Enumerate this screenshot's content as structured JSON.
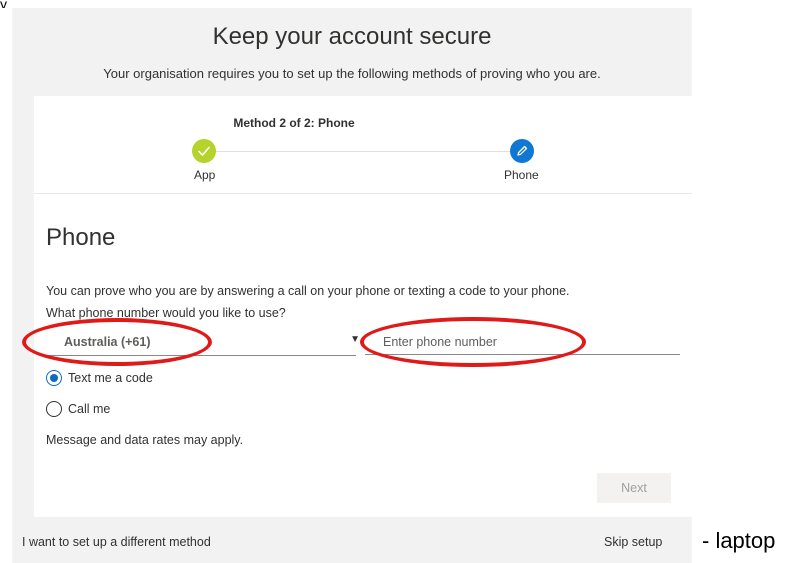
{
  "page": {
    "title": "Keep your account secure",
    "subtitle": "Your organisation requires you to set up the following methods of proving who you are."
  },
  "progress": {
    "label": "Method 2 of 2: Phone",
    "steps": [
      {
        "name": "App",
        "status": "complete",
        "icon": "check-icon",
        "color": "#b4d32c"
      },
      {
        "name": "Phone",
        "status": "current",
        "icon": "pencil-icon",
        "color": "#0f78d4"
      }
    ]
  },
  "section": {
    "title": "Phone",
    "description": "You can prove who you are by answering a call on your phone or texting a code to your phone.",
    "question": "What phone number would you like to use?"
  },
  "country": {
    "selected": "Australia (+61)"
  },
  "phone_input": {
    "placeholder": "Enter phone number",
    "value": ""
  },
  "options": [
    {
      "label": "Text me a code",
      "checked": true
    },
    {
      "label": "Call me",
      "checked": false
    }
  ],
  "rates_note": "Message and data rates may apply.",
  "buttons": {
    "next": "Next"
  },
  "footer": {
    "different_method": "I want to set up a different method",
    "skip": "Skip setup"
  },
  "annotation": {
    "side_note": "- laptop",
    "top_fragment": "y",
    "ellipse_color": "#e01919"
  }
}
